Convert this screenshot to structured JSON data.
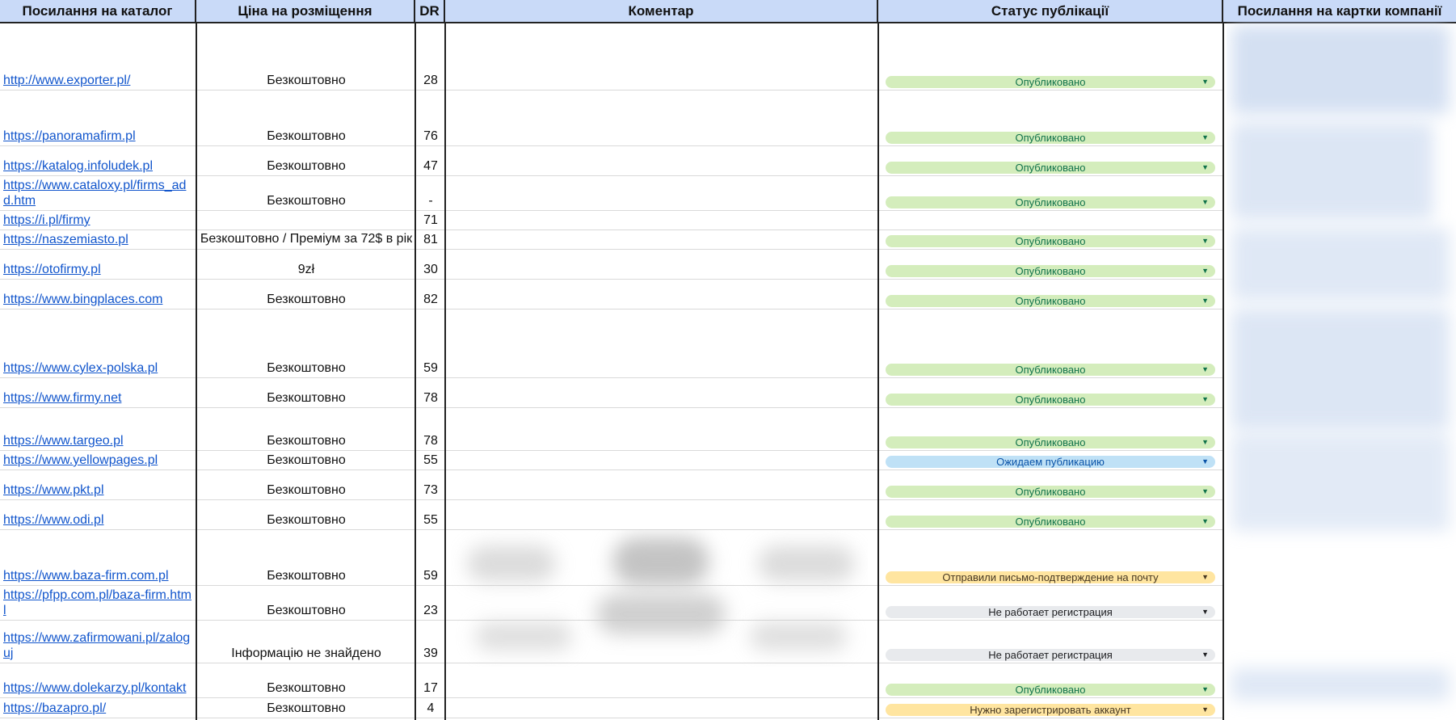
{
  "header": {
    "col_catalog": "Посилання на каталог",
    "col_price": "Ціна на розміщення",
    "col_dr": "DR",
    "col_comment": "Коментар",
    "col_status": "Статус публікації",
    "col_cards": "Посилання на картки компанії"
  },
  "status_colors": {
    "published": "#d4edbc",
    "awaiting": "#bfe1f6",
    "email_sent": "#ffe5a0",
    "not_working": "#e8eaed",
    "need_register": "#ffe5a0"
  },
  "rows": [
    {
      "url": "http://www.exporter.pl/",
      "price": "Безкоштовно",
      "dr": "28",
      "status": "Опубликовано"
    },
    {
      "url": "https://panoramafirm.pl",
      "price": "Безкоштовно",
      "dr": "76",
      "status": "Опубликовано"
    },
    {
      "url": "https://katalog.infoludek.pl",
      "price": "Безкоштовно",
      "dr": "47",
      "status": "Опубликовано"
    },
    {
      "url": "https://www.cataloxy.pl/firms_add.htm",
      "price": "Безкоштовно",
      "dr": "-",
      "status": "Опубликовано"
    },
    {
      "url": "https://i.pl/firmy",
      "price": "Безкоштовно / Преміум за 72$ в рік",
      "dr": "71",
      "status": ""
    },
    {
      "url": "https://naszemiasto.pl",
      "price": "",
      "dr": "81",
      "status": "Опубликовано"
    },
    {
      "url": "https://otofirmy.pl",
      "price": "9zł",
      "dr": "30",
      "status": "Опубликовано"
    },
    {
      "url": "https://www.bingplaces.com",
      "price": "Безкоштовно",
      "dr": "82",
      "status": "Опубликовано"
    },
    {
      "url": "https://www.cylex-polska.pl",
      "price": "Безкоштовно",
      "dr": "59",
      "status": "Опубликовано"
    },
    {
      "url": "https://www.firmy.net",
      "price": "Безкоштовно",
      "dr": "78",
      "status": "Опубликовано"
    },
    {
      "url": "https://www.targeo.pl",
      "price": "Безкоштовно",
      "dr": "78",
      "status": "Опубликовано"
    },
    {
      "url": "https://www.yellowpages.pl",
      "price": "Безкоштовно",
      "dr": "55",
      "status": "Ожидаем публикацию"
    },
    {
      "url": "https://www.pkt.pl",
      "price": "Безкоштовно",
      "dr": "73",
      "status": "Опубликовано"
    },
    {
      "url": "https://www.odi.pl",
      "price": "Безкоштовно",
      "dr": "55",
      "status": "Опубликовано"
    },
    {
      "url": "https://www.baza-firm.com.pl",
      "price": "Безкоштовно",
      "dr": "59",
      "status": "Отправили письмо-подтверждение на почту"
    },
    {
      "url": "https://pfpp.com.pl/baza-firm.html",
      "price": "Безкоштовно",
      "dr": "23",
      "status": "Не работает регистрация"
    },
    {
      "url": "https://www.zafirmowani.pl/zaloguj",
      "price": "Інформацію не знайдено",
      "dr": "39",
      "status": "Не работает регистрация"
    },
    {
      "url": "https://www.dolekarzy.pl/kontakt",
      "price": "Безкоштовно",
      "dr": "17",
      "status": "Опубликовано"
    },
    {
      "url": "https://bazapro.pl/",
      "price": "Безкоштовно",
      "dr": "4",
      "status": "Нужно зарегистрировать аккаунт"
    }
  ]
}
